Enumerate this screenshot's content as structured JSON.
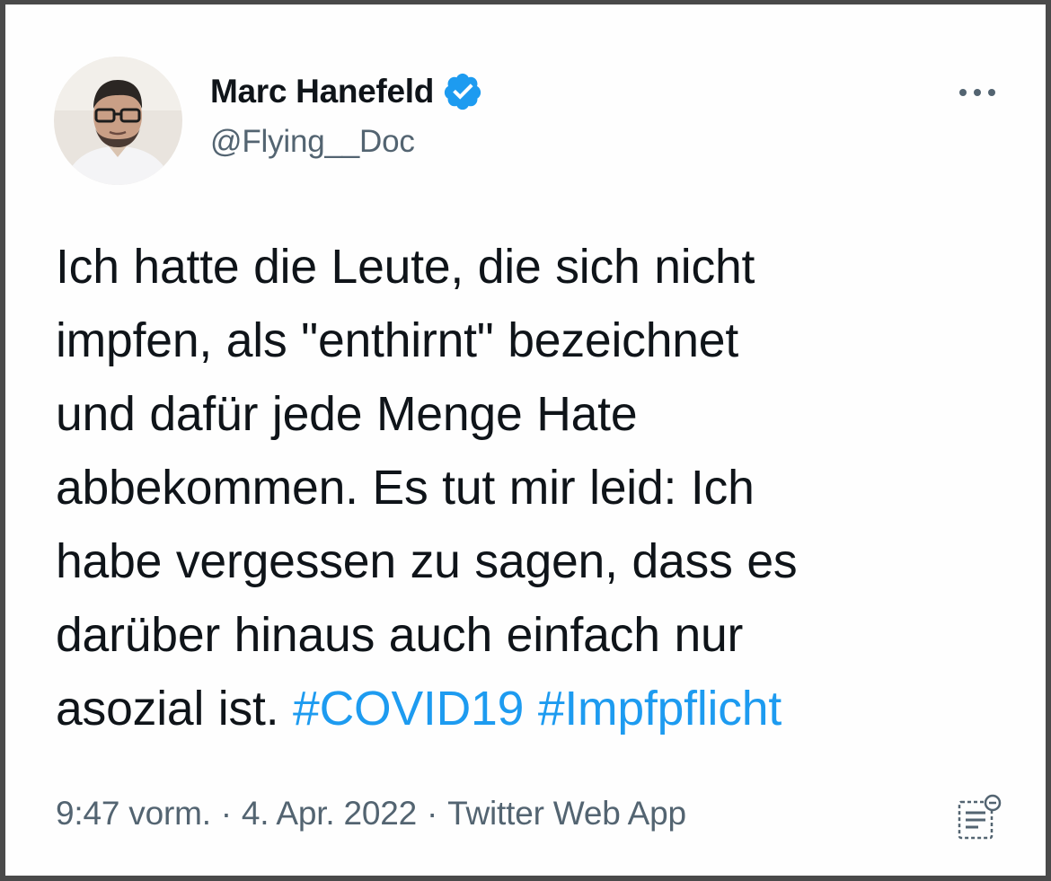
{
  "author": {
    "display_name": "Marc Hanefeld",
    "handle": "@Flying__Doc",
    "verified": true,
    "avatar_icon": "profile-photo"
  },
  "tweet": {
    "lines": [
      "Ich hatte die Leute, die sich nicht",
      "impfen, als \"enthirnt\" bezeichnet",
      "und dafür jede Menge Hate",
      "abbekommen. Es tut mir leid: Ich",
      "habe vergessen zu sagen, dass es",
      "darüber hinaus auch einfach nur",
      "asozial ist."
    ],
    "hashtags": [
      "#COVID19",
      "#Impfpflicht"
    ]
  },
  "meta": {
    "time": "9:47 vorm.",
    "separator": "·",
    "date": "4. Apr. 2022",
    "source": "Twitter Web App"
  },
  "icons": {
    "more": "more-icon",
    "verified": "verified-badge-icon",
    "analytics": "tweet-analytics-icon"
  },
  "colors": {
    "hashtag": "#1d9bf0",
    "secondary_text": "#536471",
    "primary_text": "#0f1419",
    "verified_badge": "#1d9bf0"
  }
}
